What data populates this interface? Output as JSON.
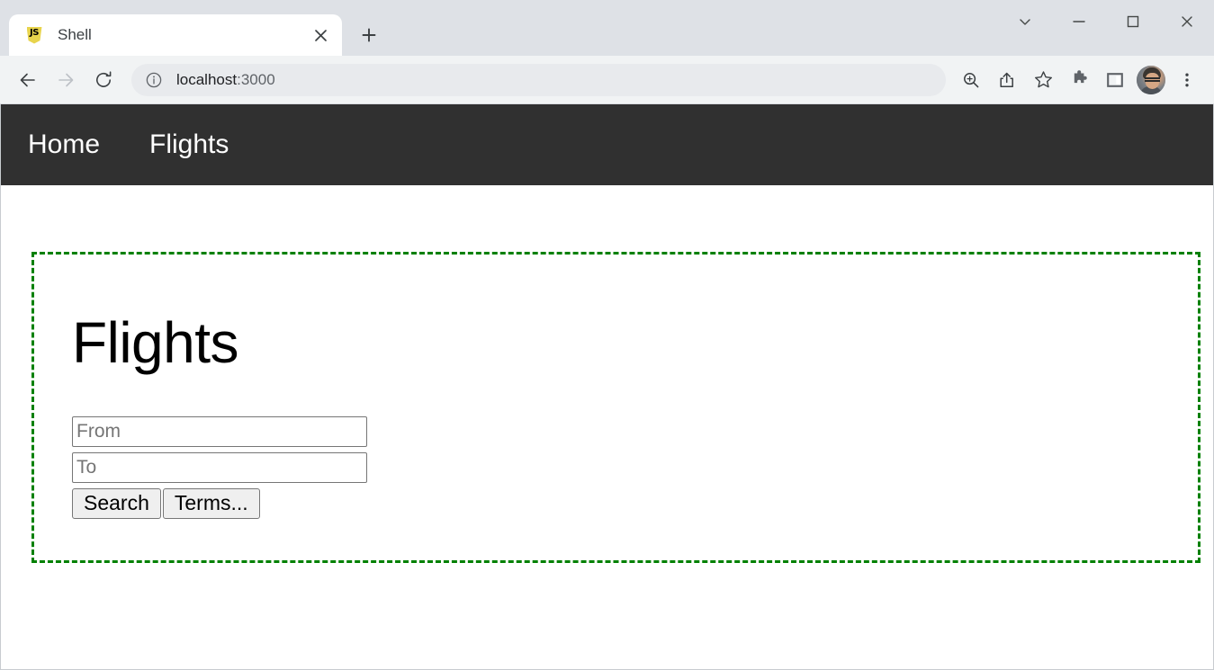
{
  "browser": {
    "tab": {
      "title": "Shell",
      "favicon": "js-logo-icon",
      "close_icon": "close-icon"
    },
    "new_tab_icon": "plus-icon",
    "window_controls": {
      "tab_search": "chevron-down-icon",
      "minimize": "minimize-icon",
      "maximize": "maximize-icon",
      "close": "close-icon"
    },
    "toolbar": {
      "back_icon": "arrow-left-icon",
      "forward_icon": "arrow-right-icon",
      "reload_icon": "reload-icon",
      "site_info_icon": "info-circle-icon",
      "url_host": "localhost",
      "url_port": ":3000",
      "url_full": "localhost:3000",
      "zoom_icon": "zoom-in-icon",
      "share_icon": "share-icon",
      "bookmark_icon": "star-icon",
      "extensions_icon": "puzzle-piece-icon",
      "side_panel_icon": "side-panel-icon",
      "profile_icon": "avatar-photo",
      "menu_icon": "three-dot-menu-icon"
    }
  },
  "site": {
    "nav": {
      "items": [
        {
          "label": "Home"
        },
        {
          "label": "Flights"
        }
      ]
    },
    "main": {
      "heading": "Flights",
      "form": {
        "from_placeholder": "From",
        "from_value": "",
        "to_placeholder": "To",
        "to_value": "",
        "search_label": "Search",
        "terms_label": "Terms..."
      }
    }
  },
  "colors": {
    "titlebar_bg": "#dee1e6",
    "toolbar_bg": "#f1f3f4",
    "omnibox_bg": "#e8eaed",
    "site_nav_bg": "#303030",
    "frame_border": "#008000",
    "button_bg": "#efefef",
    "page_bg": "#ffffff"
  }
}
